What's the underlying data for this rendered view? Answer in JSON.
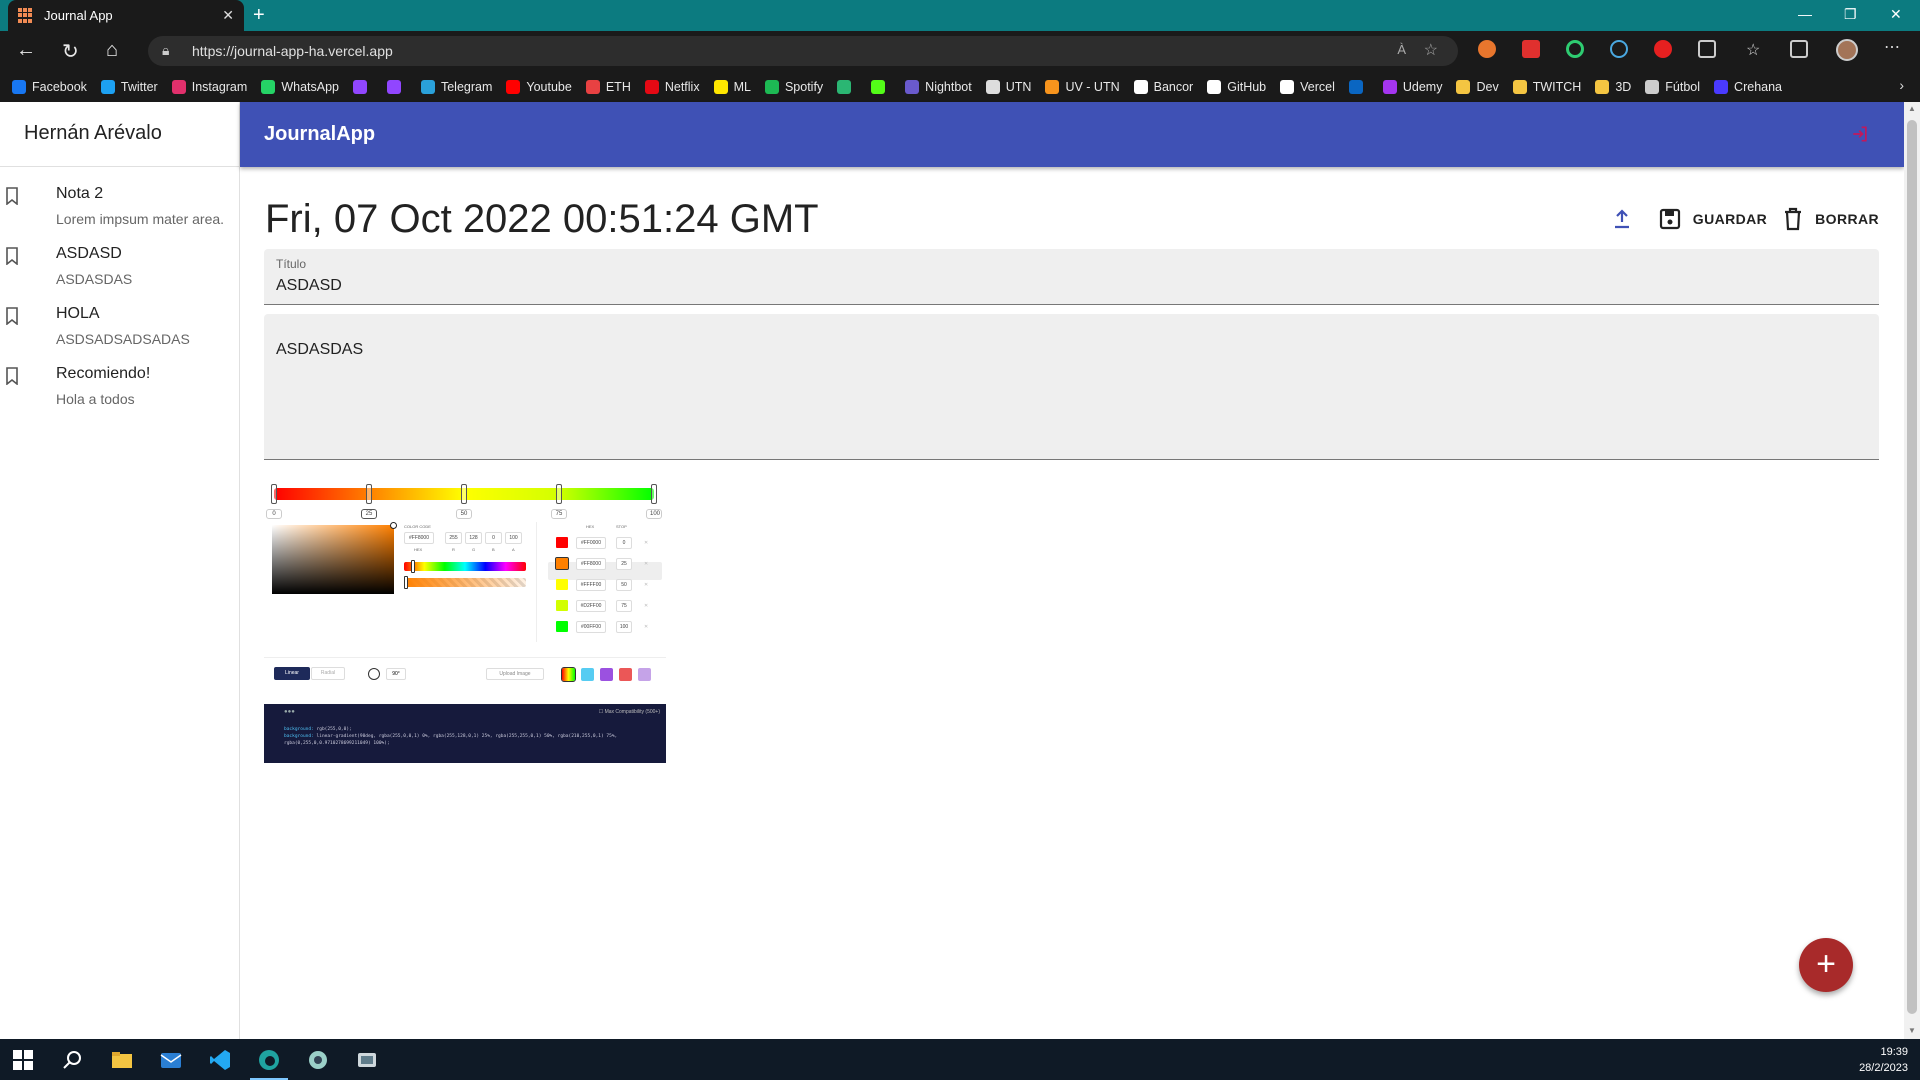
{
  "browser": {
    "tab_title": "Journal App",
    "url": "https://journal-app-ha.vercel.app",
    "read_aloud_label": "À",
    "bookmarks": [
      {
        "label": "Facebook",
        "color": "#1877f2"
      },
      {
        "label": "Twitter",
        "color": "#1da1f2"
      },
      {
        "label": "Instagram",
        "color": "#e1306c"
      },
      {
        "label": "WhatsApp",
        "color": "#25d366"
      },
      {
        "label": "",
        "color": "#9146ff"
      },
      {
        "label": "",
        "color": "#9146ff"
      },
      {
        "label": "Telegram",
        "color": "#2aa1da"
      },
      {
        "label": "Youtube",
        "color": "#ff0000"
      },
      {
        "label": "ETH",
        "color": "#e84142"
      },
      {
        "label": "Netflix",
        "color": "#e50914"
      },
      {
        "label": "ML",
        "color": "#ffe600"
      },
      {
        "label": "Spotify",
        "color": "#1db954"
      },
      {
        "label": "",
        "color": "#2bb673"
      },
      {
        "label": "",
        "color": "#53fc18"
      },
      {
        "label": "Nightbot",
        "color": "#6a5acd"
      },
      {
        "label": "UTN",
        "color": "#dddddd"
      },
      {
        "label": "UV - UTN",
        "color": "#f7941d"
      },
      {
        "label": "Bancor",
        "color": "#ffffff"
      },
      {
        "label": "GitHub",
        "color": "#ffffff"
      },
      {
        "label": "Vercel",
        "color": "#ffffff"
      },
      {
        "label": "",
        "color": "#0a66c2"
      },
      {
        "label": "Udemy",
        "color": "#a435f0"
      },
      {
        "label": "Dev",
        "color": "#f4c542"
      },
      {
        "label": "TWITCH",
        "color": "#f4c542"
      },
      {
        "label": "3D",
        "color": "#f4c542"
      },
      {
        "label": "Fútbol",
        "color": "#cccccc"
      },
      {
        "label": "Crehana",
        "color": "#4a3aff"
      }
    ]
  },
  "sidebar": {
    "user_name": "Hernán Arévalo",
    "notes": [
      {
        "title": "Nota 2",
        "body": "Lorem impsum mater area."
      },
      {
        "title": "ASDASD",
        "body": "ASDASDAS"
      },
      {
        "title": "HOLA",
        "body": "ASDSADSADSADAS"
      },
      {
        "title": "Recomiendo!",
        "body": "Hola a todos"
      }
    ]
  },
  "appbar": {
    "brand": "JournalApp"
  },
  "editor": {
    "date": "Fri, 07 Oct 2022 00:51:24 GMT",
    "save_label": "GUARDAR",
    "delete_label": "BORRAR",
    "title_label": "Título",
    "title_value": "ASDASD",
    "body_value": "ASDASDAS"
  },
  "picker": {
    "stops": [
      {
        "label": "0",
        "hex": "#FF0000",
        "value": "0",
        "color": "#ff0000"
      },
      {
        "label": "25",
        "hex": "#FF8000",
        "value": "25",
        "color": "#ff8000"
      },
      {
        "label": "50",
        "hex": "#FFFF00",
        "value": "50",
        "color": "#ffff00"
      },
      {
        "label": "75",
        "hex": "#D2FF00",
        "value": "75",
        "color": "#d2ff00"
      },
      {
        "label": "100",
        "hex": "#00FF00",
        "value": "100",
        "color": "#00ff00"
      }
    ],
    "color_code_label": "COLOR CODE",
    "hex_label": "HEX",
    "stop_label": "STOP",
    "current_hex": "#FF8000",
    "rgb": [
      "255",
      "128",
      "0",
      "100"
    ],
    "rgb_labels": [
      "R",
      "G",
      "B",
      "A"
    ],
    "linear_label": "Linear",
    "radial_label": "Radial",
    "angle": "90°",
    "upload_label": "Upload Image",
    "preset_colors": [
      "#f2c94c",
      "#56ccf2",
      "#9b51e0",
      "#eb5757",
      "#c5a3e8"
    ],
    "max_compat_label": "Max Compatibility (500+)",
    "code_line_1_key": "background:",
    "code_line_1_val": "rgb(255,0,0);",
    "code_line_2_key": "background:",
    "code_line_2_val": "linear-gradient(90deg, rgba(255,0,0,1) 0%, rgba(255,128,0,1) 25%, rgba(255,255,0,1) 50%, rgba(210,255,0,1) 75%,",
    "code_line_3_val": "rgba(0,255,0,0.9710278699211049) 100%);"
  },
  "taskbar": {
    "time": "19:39",
    "date": "28/2/2023"
  },
  "colors": {
    "appbar": "#3f51b5",
    "fab": "#a82a2a",
    "tabbar": "#0c7b80"
  }
}
